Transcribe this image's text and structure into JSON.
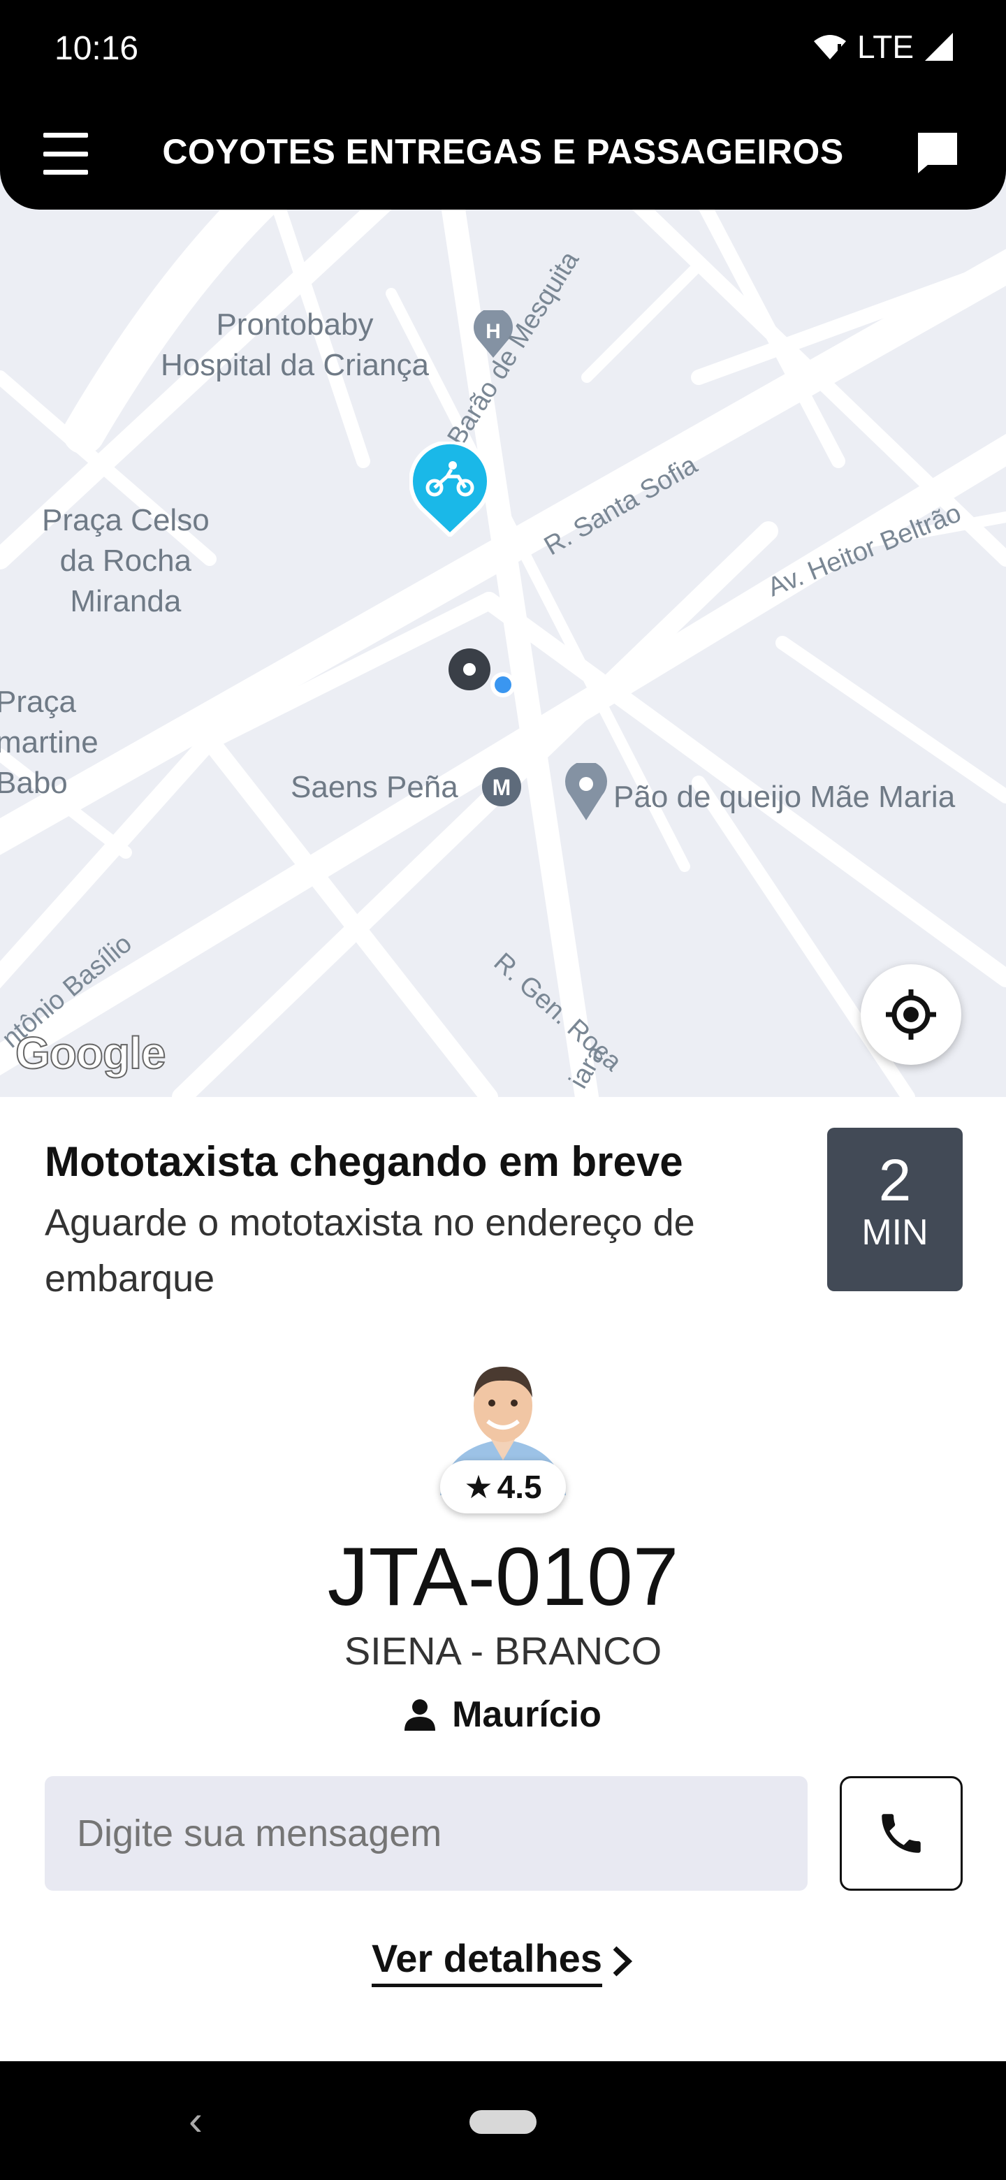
{
  "status_bar": {
    "time": "10:16",
    "network": "LTE"
  },
  "app_bar": {
    "title": "COYOTES ENTREGAS E PASSAGEIROS"
  },
  "map": {
    "labels": {
      "hospital": "Prontobaby\nHospital da Criança",
      "praca_celso": "Praça Celso\nda Rocha\nMiranda",
      "praca_lamartine": "Praça\nmartine\nBabo",
      "saens_pena": "Saens Peña",
      "pao_de_queijo": "Pão de queijo Mãe Maria",
      "barao_mesquita": "R. Barão de Mesquita",
      "santa_sofia": "R. Santa Sofia",
      "heitor_beltrao": "Av. Heitor Beltrão",
      "antonio_basilio": "ntônio Basílio",
      "gen_roca": "R. Gen. Roca",
      "ciara": "iara"
    },
    "attribution": "Google",
    "marker_color": "#1ab8e8"
  },
  "trip": {
    "status_title": "Mototaxista chegando em breve",
    "status_subtitle": "Aguarde o mototaxista no endereço de embarque",
    "eta_value": "2",
    "eta_unit": "MIN"
  },
  "driver": {
    "rating": "4.5",
    "plate": "JTA-0107",
    "vehicle": "SIENA - BRANCO",
    "name": "Maurício"
  },
  "message_input": {
    "placeholder": "Digite sua mensagem"
  },
  "details_link": "Ver detalhes"
}
